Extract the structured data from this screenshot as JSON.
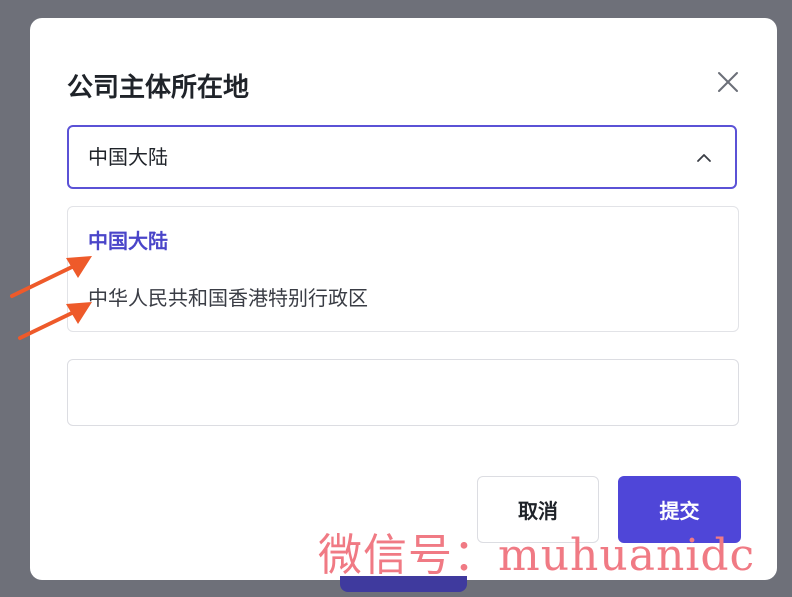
{
  "dialog": {
    "title": "公司主体所在地",
    "close_icon": "close-icon"
  },
  "select": {
    "value": "中国大陆",
    "chevron_icon": "chevron-up-icon",
    "accent_color": "#5b52d6"
  },
  "dropdown": {
    "options": [
      {
        "label": "中国大陆",
        "selected": true
      },
      {
        "label": "中华人民共和国香港特别行政区",
        "selected": false
      }
    ]
  },
  "text_input": {
    "value": ""
  },
  "buttons": {
    "cancel_label": "取消",
    "submit_label": "提交",
    "submit_color": "#4f46d8"
  },
  "annotations": {
    "arrow_color": "#ee5a2a"
  },
  "watermark": {
    "text": "微信号：muhuanidc"
  }
}
